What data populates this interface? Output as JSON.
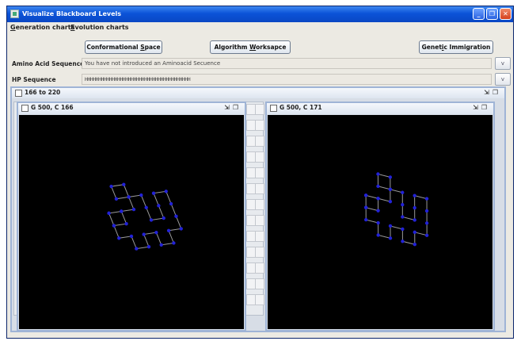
{
  "window": {
    "title": "Visualize Blackboard Levels"
  },
  "menubar": {
    "generation_charts": {
      "u": "G",
      "rest": "eneration charts"
    },
    "evolution_charts": {
      "u": "E",
      "rest": "volution charts"
    }
  },
  "toolbar": {
    "conformational": {
      "pre": "Conformational ",
      "u": "S",
      "post": "pace"
    },
    "algorithm": {
      "pre": "Algorithm ",
      "u": "W",
      "post": "orksapce"
    },
    "genetic": {
      "pre": "Genet",
      "u": "i",
      "post": "c Immigration"
    }
  },
  "fields": {
    "amino_label": "Amino Acid Sequence",
    "amino_value": "You have not introduced an Aminoacid Secuence",
    "hp_label": "HP Sequence",
    "hp_value": "HHHHHHHHHHHHHHHHHHHHHHHHHHHHHHHHHHHHHHH",
    "expand_label": "v"
  },
  "outer_frame": {
    "title": "166 to 220"
  },
  "frames": [
    {
      "title": "G 500, C 166"
    },
    {
      "title": "G 500, C 171"
    }
  ],
  "icons": {
    "restore": "⇲",
    "maximize": "❐",
    "minimize": "_",
    "close": "✕"
  },
  "colors": {
    "title_bar": "#0b53d8",
    "canvas": "#000000",
    "node": "#2222d8",
    "bond": "#9a9a9a"
  }
}
